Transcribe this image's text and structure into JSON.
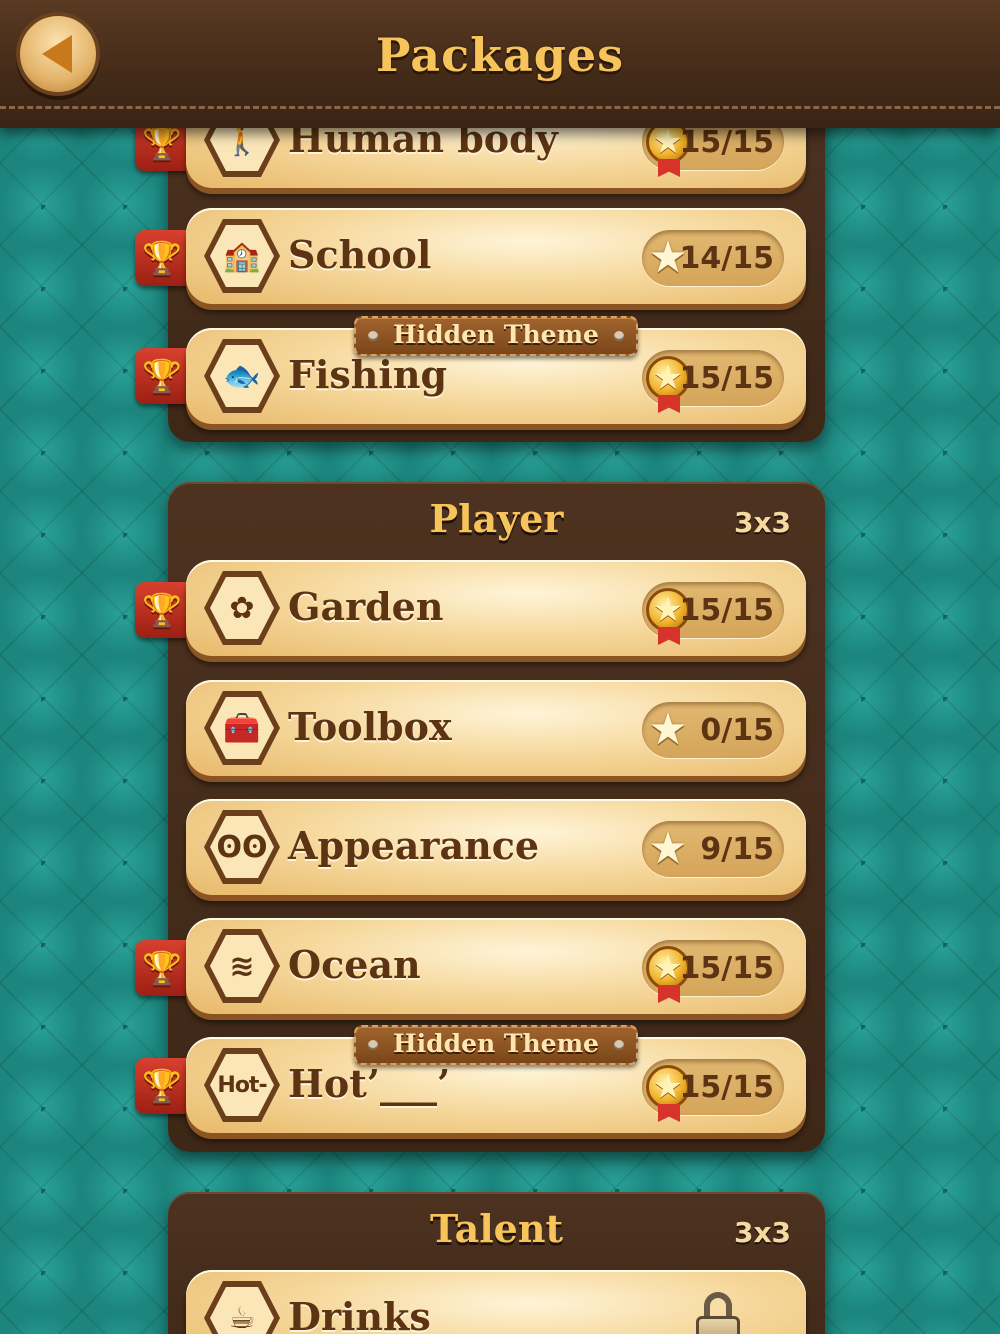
{
  "header": {
    "title": "Packages"
  },
  "panels": [
    {
      "title": "",
      "size": "",
      "rows": [
        {
          "label": "Human body",
          "icon": "person-icon",
          "score": "15/15",
          "complete": true
        },
        {
          "label": "School",
          "icon": "school-icon",
          "score": "14/15",
          "complete": false
        },
        {
          "label": "Fishing",
          "icon": "fish-icon",
          "score": "15/15",
          "complete": true,
          "tag": "Hidden Theme"
        }
      ]
    },
    {
      "title": "Player",
      "size": "3x3",
      "rows": [
        {
          "label": "Garden",
          "icon": "flower-icon",
          "score": "15/15",
          "complete": true
        },
        {
          "label": "Toolbox",
          "icon": "toolbox-icon",
          "score": "0/15",
          "complete": false
        },
        {
          "label": "Appearance",
          "icon": "glasses-mustache-icon",
          "score": "9/15",
          "complete": false
        },
        {
          "label": "Ocean",
          "icon": "whale-tail-icon",
          "score": "15/15",
          "complete": true
        },
        {
          "label": "Hot’___’",
          "icon_text": "Hot-",
          "score": "15/15",
          "complete": true,
          "tag": "Hidden Theme"
        }
      ]
    },
    {
      "title": "Talent",
      "size": "3x3",
      "rows": [
        {
          "label": "Drinks",
          "icon": "cup-heart-icon",
          "locked": true
        }
      ]
    }
  ],
  "colors": {
    "background": "#1f8c84",
    "leather": "#432a18",
    "gold_text": "#f6c45a",
    "row_text": "#5c3414",
    "ribbon_red": "#d6332a"
  }
}
